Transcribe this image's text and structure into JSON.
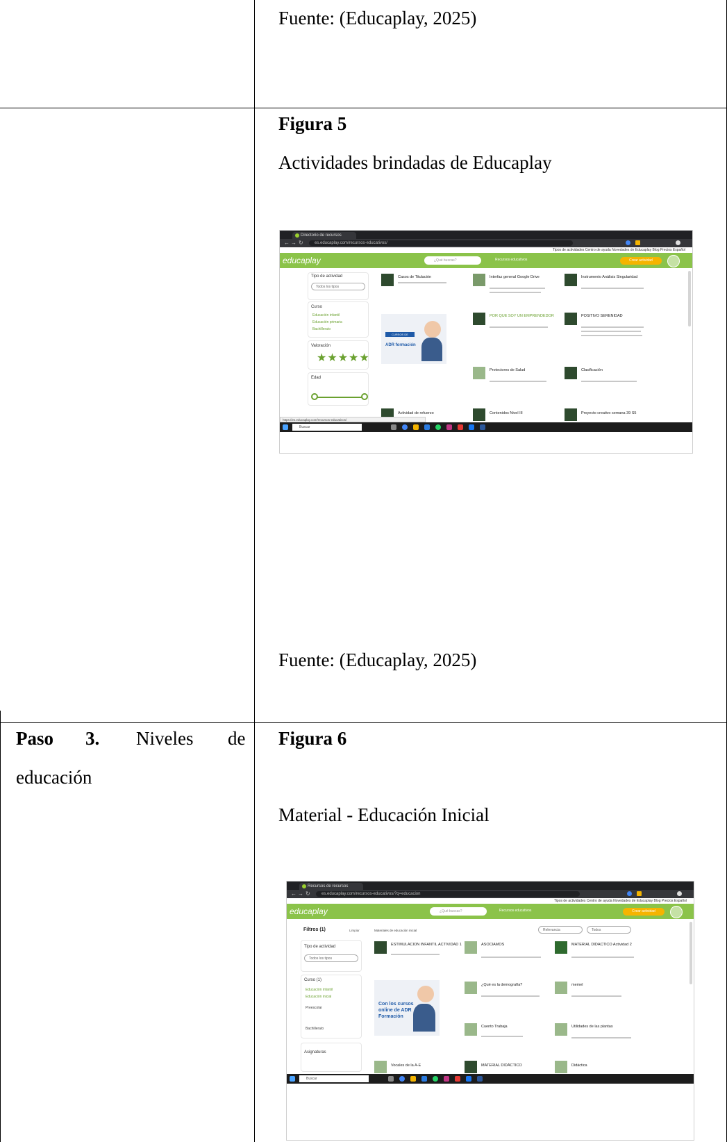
{
  "row1": {
    "source": "Fuente: (Educaplay, 2025)"
  },
  "row2": {
    "figure_label": "Figura 5",
    "caption": "Actividades brindadas de Educaplay",
    "source": "Fuente: (Educaplay, 2025)",
    "screenshot": {
      "tab_title": "Directorio de recursos educativ... ×",
      "url": "es.educaplay.com/recursos-educativos/",
      "top_links": "Tipos de actividades   Centro de ayuda   Novedades de Educaplay   Blog   Precios   Español",
      "logo": "educaplay",
      "search_placeholder": "¿Qué buscas?",
      "header_label": "Recursos educativos",
      "create_button": "Crear actividad",
      "filter_type_title": "Tipo de actividad",
      "filter_type_value": "Todos los tipos",
      "filter_course_title": "Curso",
      "filter_course_items": [
        "Educación infantil",
        "Educación primaria",
        "Bachillerato"
      ],
      "rating_title": "Valoración",
      "rating_stars": "★★★★★",
      "age_title": "Edad",
      "cards": [
        "Casos de Titulación",
        "Interfaz general Google Drive",
        "Instrumento Análisis Singularidad",
        "POR QUE SOY UN EMPRENDEDOR",
        "POSITIVO SERENIDAD",
        "Protectores de Salud",
        "Clasificación",
        "Actividad de refuerzo",
        "Contenidos Nivel III",
        "Proyecto creativo semana 39 S5"
      ],
      "promo_button": "CURSOS DE FORMACIÓN",
      "promo_brand": "ADR formación",
      "status_url": "https://es.educaplay.com/recursos-educativos/",
      "taskbar_search": "Buscar"
    }
  },
  "row3": {
    "step_bold_a": "Paso",
    "step_bold_b": "3.",
    "step_rest_a": "Niveles",
    "step_rest_b": "de",
    "step_line2": "educación",
    "figure_label": "Figura 6",
    "caption": "Material - Educación Inicial",
    "screenshot": {
      "tab_title": "Recursos de recursos educativ... ×",
      "url": "es.educaplay.com/recursos-educativos/?q=educacion",
      "top_links": "Tipos de actividades   Centro de ayuda   Novedades de Educaplay   Blog   Precios   Español",
      "logo": "educaplay",
      "search_placeholder": "¿Qué buscas?",
      "header_label": "Recursos educativos",
      "create_button": "Crear actividad",
      "filters_title": "Filtros (1)",
      "filters_clear": "Limpiar",
      "results_text": "Materiales de educación inicial",
      "sort_a": "Relevancia",
      "sort_b": "Todos",
      "filter_type_title": "Tipo de actividad",
      "filter_type_value": "Todos los tipos",
      "filter_course_title": "Curso (1)",
      "filter_course_items": [
        "Educación infantil",
        "Educación inicial",
        "Preescolar",
        "Bachillerato"
      ],
      "subjects_title": "Asignaturas",
      "cards": [
        "ESTIMULACION INFANTIL ACTIVIDAD 1",
        "ASOCIAMOS",
        "MATERIAL DIDACTICO Actividad 2",
        "¿Qué es la demografía?",
        "memel",
        "Cuento Trabaja",
        "Utilidades de las plantas",
        "Vocales de la A-E",
        "MATERIAL DIDÁCTICO",
        "Didáctica"
      ],
      "promo_text": "Con los cursos online de ADR Formación",
      "taskbar_search": "Buscar"
    }
  }
}
